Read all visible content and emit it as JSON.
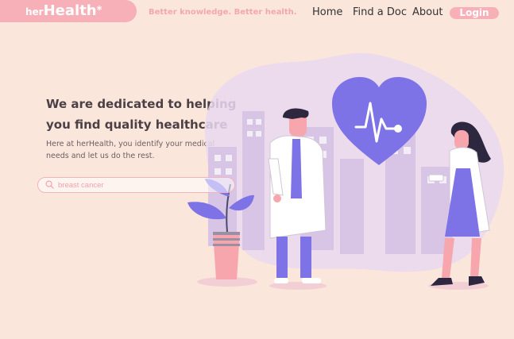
{
  "header": {
    "logo_prefix": "her",
    "logo_main": "Health",
    "logo_star": "*",
    "tagline": "Better knowledge. Better health.",
    "nav": [
      {
        "label": "Home"
      },
      {
        "label": "Find a Doc"
      },
      {
        "label": "About"
      }
    ],
    "login_label": "Login"
  },
  "hero": {
    "title": "We are dedicated to helping you find quality healthcare",
    "description": "Here at herHealth,  you identify your medical needs and let us do the rest.",
    "search_value": "breast cancer"
  },
  "illustration": {
    "icons": [
      "heart-icon",
      "heartbeat-icon",
      "doctor-male",
      "doctor-female",
      "potted-plant",
      "city-buildings"
    ]
  },
  "colors": {
    "background": "#fbe6dc",
    "accent": "#f7b0b8",
    "purple": "#7d72e6"
  }
}
